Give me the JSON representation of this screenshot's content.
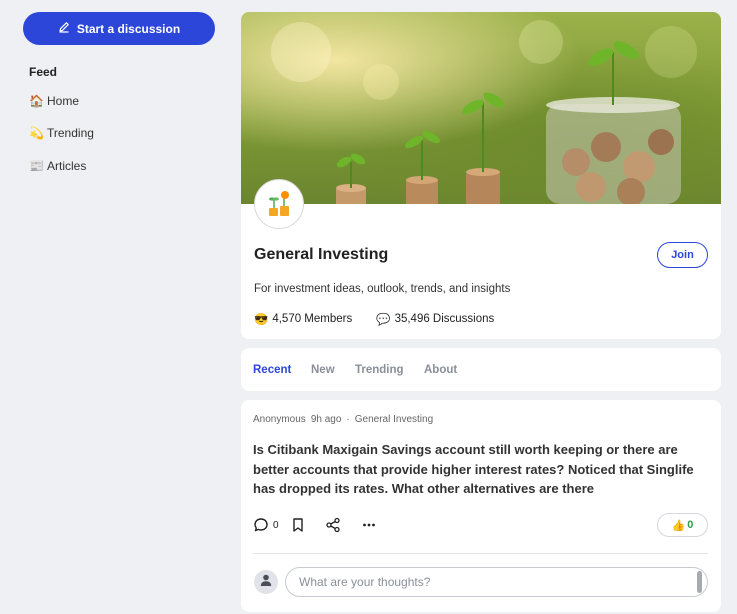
{
  "sidebar": {
    "start_button": "Start a discussion",
    "feed_label": "Feed",
    "items": [
      {
        "emoji": "🏠",
        "label": "Home"
      },
      {
        "emoji": "💫",
        "label": "Trending"
      },
      {
        "emoji": "📰",
        "label": "Articles"
      }
    ]
  },
  "group": {
    "title": "General Investing",
    "join_label": "Join",
    "description": "For investment ideas, outlook, trends, and insights",
    "members_emoji": "😎",
    "members": "4,570 Members",
    "discussions_emoji": "💬",
    "discussions": "35,496 Discussions"
  },
  "tabs": [
    {
      "label": "Recent",
      "active": true
    },
    {
      "label": "New",
      "active": false
    },
    {
      "label": "Trending",
      "active": false
    },
    {
      "label": "About",
      "active": false
    }
  ],
  "post": {
    "author": "Anonymous",
    "time": "9h ago",
    "separator": "·",
    "group": "General Investing",
    "title": "Is Citibank Maxigain Savings account still worth keeping or there are better accounts that provide higher interest rates? Noticed that Singlife has dropped its rates. What other alternatives are there",
    "comment_count": "0",
    "like_emoji": "👍",
    "like_count": "0",
    "reply_placeholder": "What are your thoughts?"
  },
  "colors": {
    "accent": "#2c46d9",
    "like_green": "#2e9e4a",
    "background": "#eff0f3"
  },
  "icons": [
    "pencil-icon",
    "comment-icon",
    "bookmark-icon",
    "share-icon",
    "more-icon",
    "user-icon",
    "thumbs-up-icon"
  ]
}
